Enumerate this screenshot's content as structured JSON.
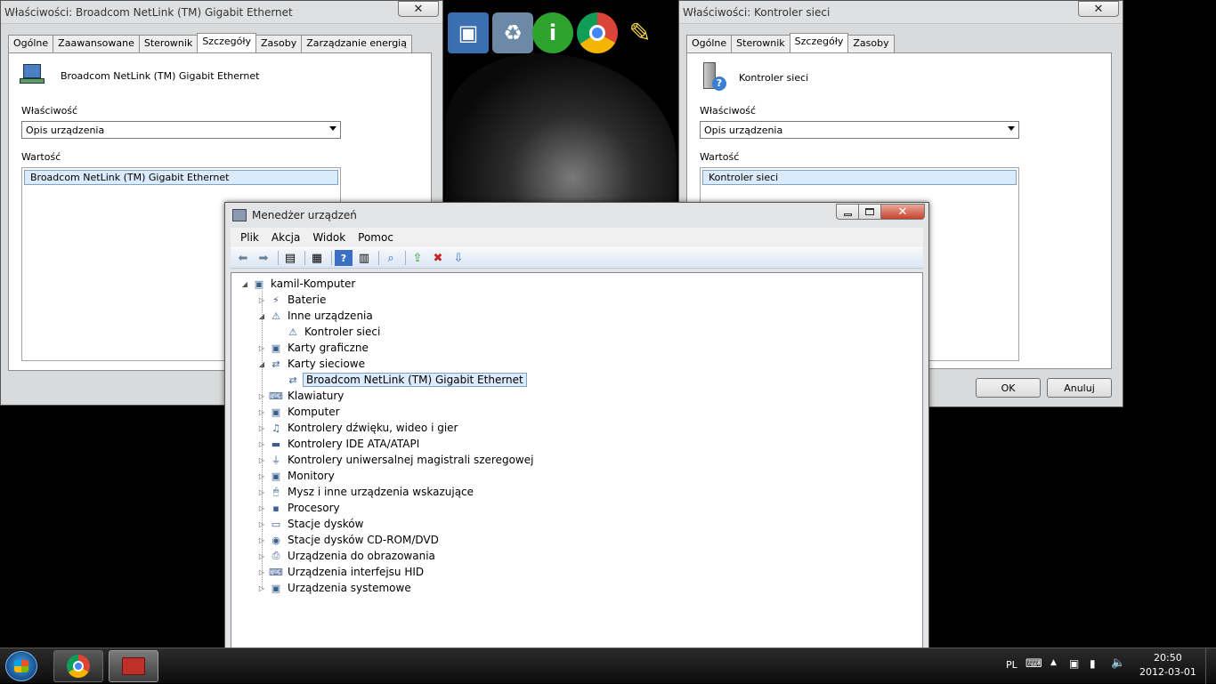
{
  "left_props": {
    "title": "Właściwości: Broadcom NetLink (TM) Gigabit Ethernet",
    "tabs": [
      "Ogólne",
      "Zaawansowane",
      "Sterownik",
      "Szczegóły",
      "Zasoby",
      "Zarządzanie energią"
    ],
    "active_tab": "Szczegóły",
    "device_name": "Broadcom NetLink (TM) Gigabit Ethernet",
    "property_label": "Właściwość",
    "property_value": "Opis urządzenia",
    "value_label": "Wartość",
    "value_item": "Broadcom NetLink (TM) Gigabit Ethernet",
    "close_label": "✕"
  },
  "right_props": {
    "title": "Właściwości: Kontroler sieci",
    "tabs": [
      "Ogólne",
      "Sterownik",
      "Szczegóły",
      "Zasoby"
    ],
    "active_tab": "Szczegóły",
    "device_name": "Kontroler sieci",
    "property_label": "Właściwość",
    "property_value": "Opis urządzenia",
    "value_label": "Wartość",
    "value_item": "Kontroler sieci",
    "ok_label": "OK",
    "cancel_label": "Anuluj",
    "close_label": "✕"
  },
  "device_manager": {
    "title": "Menedżer urządzeń",
    "menu": [
      "Plik",
      "Akcja",
      "Widok",
      "Pomoc"
    ],
    "root": "kamil-Komputer",
    "categories": [
      {
        "label": "Baterie",
        "expanded": false
      },
      {
        "label": "Inne urządzenia",
        "expanded": true,
        "children": [
          "Kontroler sieci"
        ]
      },
      {
        "label": "Karty graficzne",
        "expanded": false
      },
      {
        "label": "Karty sieciowe",
        "expanded": true,
        "children": [
          "Broadcom NetLink (TM) Gigabit Ethernet"
        ]
      },
      {
        "label": "Klawiatury",
        "expanded": false
      },
      {
        "label": "Komputer",
        "expanded": false
      },
      {
        "label": "Kontrolery dźwięku, wideo i gier",
        "expanded": false
      },
      {
        "label": "Kontrolery IDE ATA/ATAPI",
        "expanded": false
      },
      {
        "label": "Kontrolery uniwersalnej magistrali szeregowej",
        "expanded": false
      },
      {
        "label": "Monitory",
        "expanded": false
      },
      {
        "label": "Mysz i inne urządzenia wskazujące",
        "expanded": false
      },
      {
        "label": "Procesory",
        "expanded": false
      },
      {
        "label": "Stacje dysków",
        "expanded": false
      },
      {
        "label": "Stacje dysków CD-ROM/DVD",
        "expanded": false
      },
      {
        "label": "Urządzenia do obrazowania",
        "expanded": false
      },
      {
        "label": "Urządzenia interfejsu HID",
        "expanded": false
      },
      {
        "label": "Urządzenia systemowe",
        "expanded": false
      }
    ],
    "selected": "Broadcom NetLink (TM) Gigabit Ethernet"
  },
  "desktop_icons": [
    "computer-icon",
    "recycle-bin-icon",
    "info-icon",
    "chrome-icon",
    "bulb-icon"
  ],
  "taskbar": {
    "language": "PL",
    "time": "20:50",
    "date": "2012-03-01",
    "tasks": [
      "chrome-icon",
      "toolbox-icon"
    ]
  },
  "colors": {
    "selection": "#dcebfc",
    "selection_border": "#7da2ce",
    "desktop": "#000000"
  }
}
